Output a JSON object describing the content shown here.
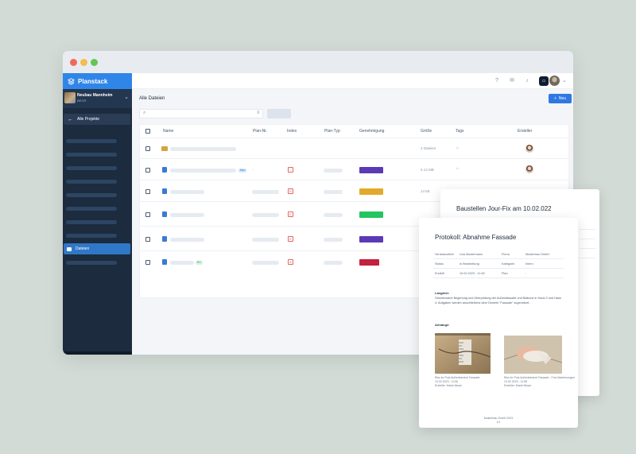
{
  "app": {
    "brand": "Planstack",
    "project": {
      "name": "Neubau Mannheim",
      "code": "BEOR"
    },
    "back_link": "Alle Projekte",
    "active_nav": "Dateien"
  },
  "topbar": {
    "box_icon": "chat-icon",
    "avatar": "user-avatar"
  },
  "main": {
    "title": "Alle Dateien",
    "new_button": "Neu",
    "columns": [
      "Name",
      "Plan-Nr.",
      "Index",
      "Plan-Typ",
      "Genehmigung",
      "Größe",
      "Tags",
      "Ersteller"
    ]
  },
  "rows": [
    {
      "type": "folder",
      "size": "2 Dateien",
      "approval_color": null
    },
    {
      "type": "file",
      "badge": "Neu",
      "plan_no": "-",
      "index": "-",
      "size": "5.12 MB",
      "approval_color": "#5b3ab5"
    },
    {
      "type": "file",
      "index": "B",
      "size": "14 kB",
      "approval_color": "#e2a92a"
    },
    {
      "type": "file",
      "index": "E",
      "approval_color": "#22c55e"
    },
    {
      "type": "file",
      "index": "E",
      "approval_color": "#5b3ab5"
    },
    {
      "type": "file",
      "badge": "PC",
      "index": "A",
      "approval_color": "#c3213f"
    }
  ],
  "doc_back": {
    "title": "Baustellen Jour-Fix am 10.02.022"
  },
  "doc_front": {
    "title": "Protokoll: Abnahme Fassade",
    "fields": [
      [
        "Verantwortlich",
        "Lisa Mustermann",
        "Firma",
        "Musterbau GmbH"
      ],
      [
        "Status",
        "In Bearbeitung",
        "Kategorie",
        "Intern"
      ],
      [
        "Erstellt",
        "10.02.2023 - 11:45",
        "Plan",
        "-"
      ]
    ],
    "description_label": "Langtext:",
    "description": "Gemeinsame Begehung und Überprüfung der Außenfassade und Balkone in Haus 3 und Haus 4. Aufgaben werden anschließend dem Gewerk \"Fassade\" zugeordnet.",
    "attachments_label": "Anhänge:",
    "photos": [
      {
        "caption": [
          "Riss im Putz Außenbereich Fassade",
          "10.02.2023 - 11:50",
          "Ersteller: Marie Meyer"
        ]
      },
      {
        "caption": [
          "Riss im Putz Außenbereich Fassade - Foto Markierungen",
          "10.02.2023 - 11:55",
          "Ersteller: Marie Meyer"
        ]
      }
    ],
    "footer": [
      "Musterbau GmbH 2023",
      "1/1"
    ]
  },
  "colors": {
    "accent": "#2f86e8",
    "sidebar": "#1c2b3d",
    "new_button": "#2f78e3"
  }
}
